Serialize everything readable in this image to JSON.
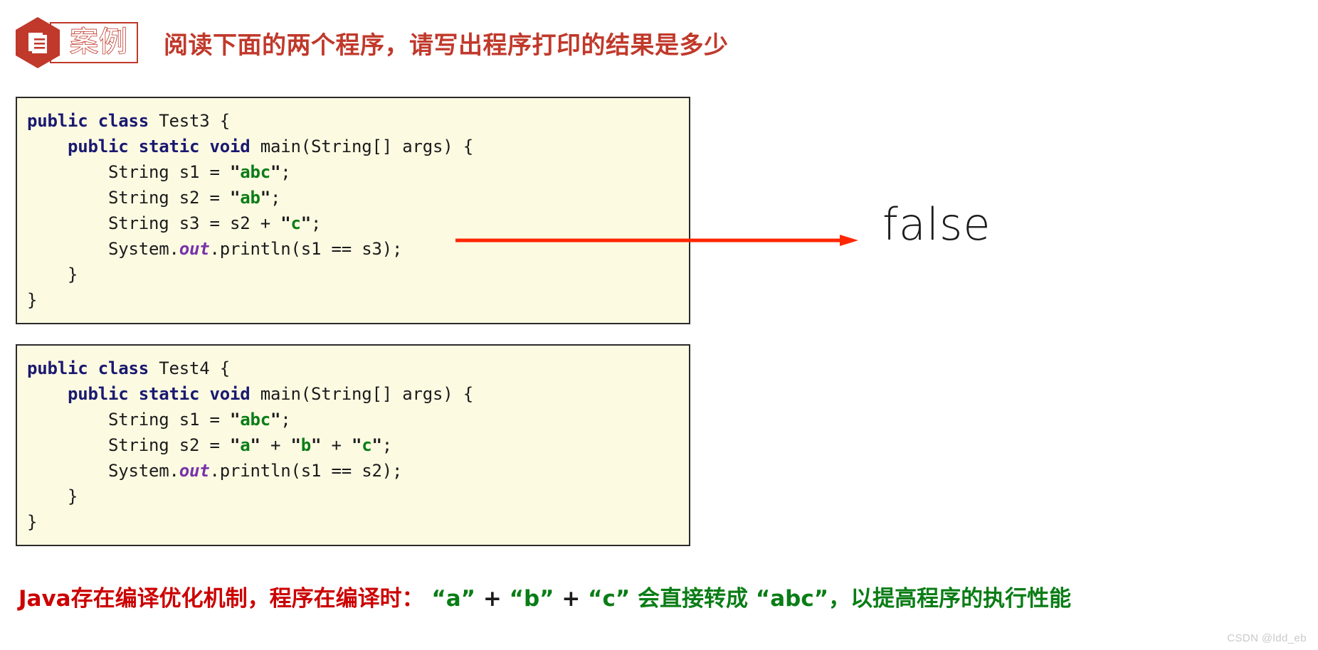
{
  "header": {
    "badge_icon": "document-list-icon",
    "badge_label": "案例",
    "title": "阅读下面的两个程序，请写出程序打印的结果是多少",
    "title_color": "#c0392b",
    "badge_color": "#c0392b"
  },
  "code_blocks": [
    {
      "id": "test3",
      "background": "#fdfae2",
      "border_color": "#2b2b2b",
      "lines": [
        [
          {
            "t": "public class ",
            "c": "kw"
          },
          {
            "t": "Test3 {",
            "c": ""
          }
        ],
        [
          {
            "t": "    ",
            "c": ""
          },
          {
            "t": "public static void ",
            "c": "kw"
          },
          {
            "t": "main(String[] args) {",
            "c": ""
          }
        ],
        [
          {
            "t": "        String s1 = ",
            "c": ""
          },
          {
            "t": "\"",
            "c": "quote"
          },
          {
            "t": "abc",
            "c": "str"
          },
          {
            "t": "\"",
            "c": "quote"
          },
          {
            "t": ";",
            "c": ""
          }
        ],
        [
          {
            "t": "        String s2 = ",
            "c": ""
          },
          {
            "t": "\"",
            "c": "quote"
          },
          {
            "t": "ab",
            "c": "str"
          },
          {
            "t": "\"",
            "c": "quote"
          },
          {
            "t": ";",
            "c": ""
          }
        ],
        [
          {
            "t": "        String s3 = s2 + ",
            "c": ""
          },
          {
            "t": "\"",
            "c": "quote"
          },
          {
            "t": "c",
            "c": "str"
          },
          {
            "t": "\"",
            "c": "quote"
          },
          {
            "t": ";",
            "c": ""
          }
        ],
        [
          {
            "t": "        System.",
            "c": ""
          },
          {
            "t": "out",
            "c": "fieldv"
          },
          {
            "t": ".println(s1 == s3);",
            "c": ""
          }
        ],
        [
          {
            "t": "    }",
            "c": ""
          }
        ],
        [
          {
            "t": "}",
            "c": ""
          }
        ]
      ]
    },
    {
      "id": "test4",
      "background": "#fdfae2",
      "border_color": "#2b2b2b",
      "lines": [
        [
          {
            "t": "public class ",
            "c": "kw"
          },
          {
            "t": "Test4 {",
            "c": ""
          }
        ],
        [
          {
            "t": "    ",
            "c": ""
          },
          {
            "t": "public static void ",
            "c": "kw"
          },
          {
            "t": "main(String[] args) {",
            "c": ""
          }
        ],
        [
          {
            "t": "        String s1 = ",
            "c": ""
          },
          {
            "t": "\"",
            "c": "quote"
          },
          {
            "t": "abc",
            "c": "str"
          },
          {
            "t": "\"",
            "c": "quote"
          },
          {
            "t": ";",
            "c": ""
          }
        ],
        [
          {
            "t": "        String s2 = ",
            "c": ""
          },
          {
            "t": "\"",
            "c": "quote"
          },
          {
            "t": "a",
            "c": "str"
          },
          {
            "t": "\"",
            "c": "quote"
          },
          {
            "t": " + ",
            "c": ""
          },
          {
            "t": "\"",
            "c": "quote"
          },
          {
            "t": "b",
            "c": "str"
          },
          {
            "t": "\"",
            "c": "quote"
          },
          {
            "t": " + ",
            "c": ""
          },
          {
            "t": "\"",
            "c": "quote"
          },
          {
            "t": "c",
            "c": "str"
          },
          {
            "t": "\"",
            "c": "quote"
          },
          {
            "t": ";",
            "c": ""
          }
        ],
        [
          {
            "t": "        System.",
            "c": ""
          },
          {
            "t": "out",
            "c": "fieldv"
          },
          {
            "t": ".println(s1 == s2);",
            "c": ""
          }
        ],
        [
          {
            "t": "    }",
            "c": ""
          }
        ],
        [
          {
            "t": "}",
            "c": ""
          }
        ]
      ]
    }
  ],
  "annotation": {
    "arrow_color": "#ff2600",
    "answer_value": "false"
  },
  "footer": {
    "segments": [
      {
        "t": "Java存在编译优化机制，程序在编译时：",
        "c": "fn-red"
      },
      {
        "t": "  “a”",
        "c": "fn-green"
      },
      {
        "t": " + ",
        "c": "fn-dark"
      },
      {
        "t": "“b”",
        "c": "fn-green"
      },
      {
        "t": " + ",
        "c": "fn-dark"
      },
      {
        "t": "“c”",
        "c": "fn-green"
      },
      {
        "t": " 会直接转成 “abc”，以提高程序的执行性能",
        "c": "fn-green"
      }
    ]
  },
  "watermark": "CSDN @ldd_eb"
}
